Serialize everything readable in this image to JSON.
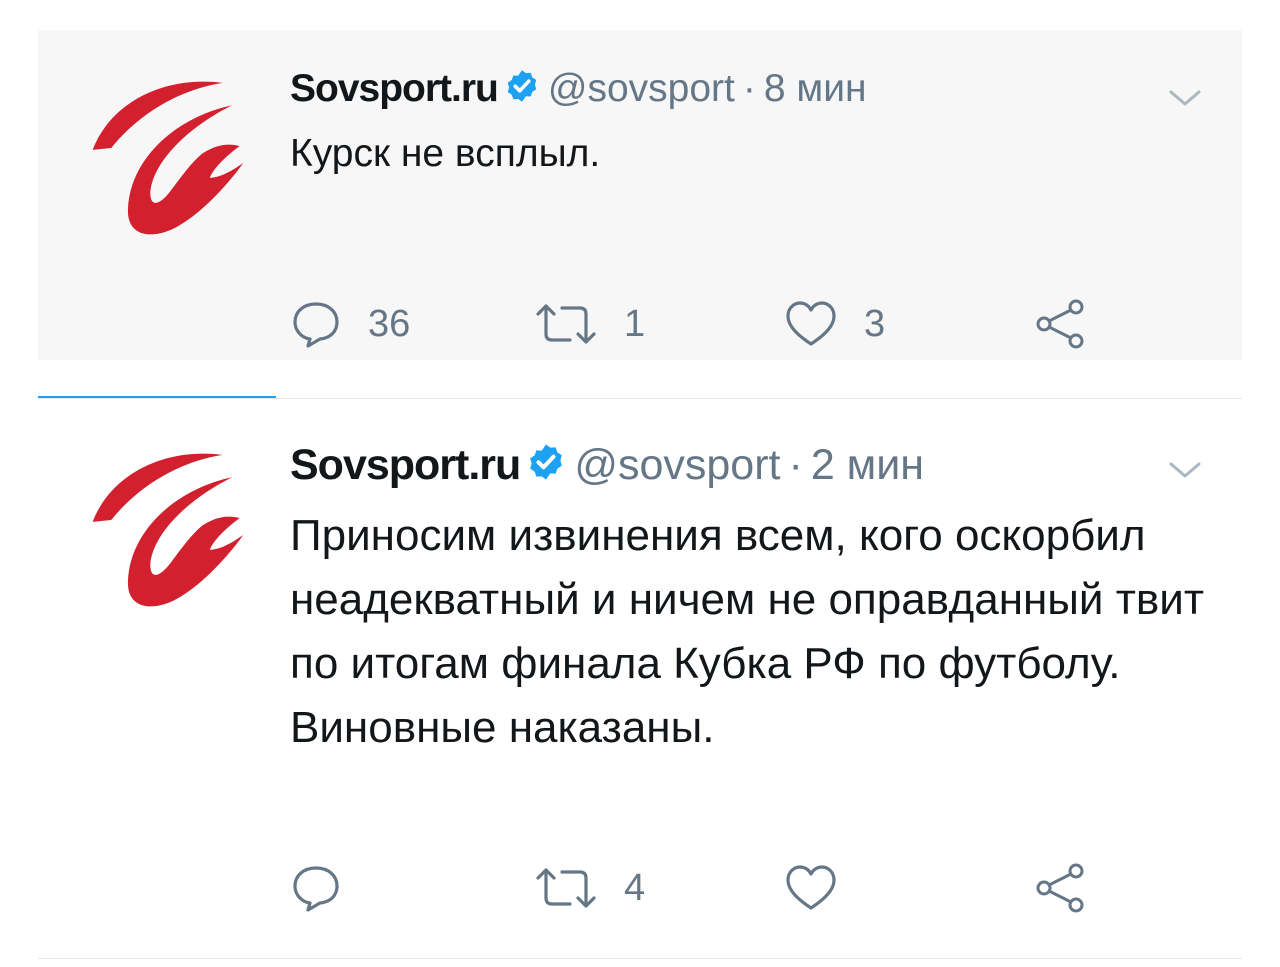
{
  "colors": {
    "brand_red": "#d2202f",
    "verified_blue": "#1da1f2",
    "secondary_text": "#657786"
  },
  "tweets": [
    {
      "avatar": "sovsport-logo",
      "name": "Sovsport.ru",
      "handle": "@sovsport",
      "separator": "·",
      "time": "8 мин",
      "text": "Курск не всплыл.",
      "actions": {
        "reply_count": "36",
        "retweet_count": "1",
        "like_count": "3"
      },
      "icons": [
        "reply-icon",
        "retweet-icon",
        "heart-icon",
        "share-icon",
        "chevron-down-icon",
        "verified-badge-icon"
      ]
    },
    {
      "avatar": "sovsport-logo",
      "name": "Sovsport.ru",
      "handle": "@sovsport",
      "separator": "·",
      "time": "2 мин",
      "text": "Приносим извинения всем, кого оскорбил неадекватный и ничем не оправданный твит по итогам финала Кубка РФ по футболу. Виновные наказаны.",
      "actions": {
        "reply_count": "",
        "retweet_count": "4",
        "like_count": ""
      },
      "icons": [
        "reply-icon",
        "retweet-icon",
        "heart-icon",
        "share-icon",
        "chevron-down-icon",
        "verified-badge-icon"
      ]
    }
  ]
}
